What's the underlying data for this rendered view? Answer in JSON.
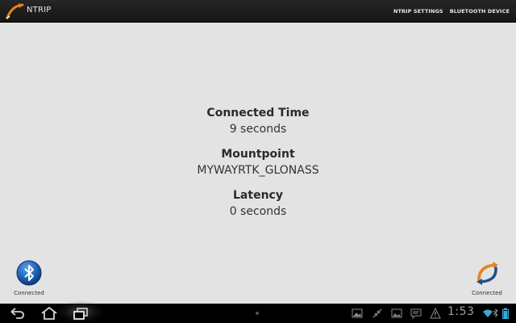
{
  "app": {
    "title": "NTRIP",
    "icon": "ntrip-logo-icon"
  },
  "menu": {
    "items": [
      {
        "label": "NTRIP SETTINGS"
      },
      {
        "label": "BLUETOOTH DEVICE"
      }
    ]
  },
  "info": {
    "connected_time": {
      "label": "Connected Time",
      "value": "9 seconds"
    },
    "mountpoint": {
      "label": "Mountpoint",
      "value": "MYWAYRTK_GLONASS"
    },
    "latency": {
      "label": "Latency",
      "value": "0 seconds"
    }
  },
  "status": {
    "bluetooth": {
      "caption": "Connected",
      "icon": "bluetooth-icon"
    },
    "ntrip": {
      "caption": "Connected",
      "icon": "ntrip-connection-icon"
    }
  },
  "systembar": {
    "clock": "1:53",
    "nav": [
      "back-icon",
      "home-icon",
      "recent-apps-icon"
    ],
    "notifications": [
      "gallery-icon",
      "usb-debug-icon",
      "image-icon",
      "message-icon",
      "warning-icon"
    ],
    "status_icons": [
      "wifi-icon",
      "bluetooth-status-icon",
      "battery-icon"
    ]
  },
  "colors": {
    "background": "#e4e3e4",
    "actionbar": "#1c1c1c",
    "accent_orange": "#e8821e",
    "bluetooth_blue": "#1f64b8",
    "clock": "#9aa3aa"
  }
}
